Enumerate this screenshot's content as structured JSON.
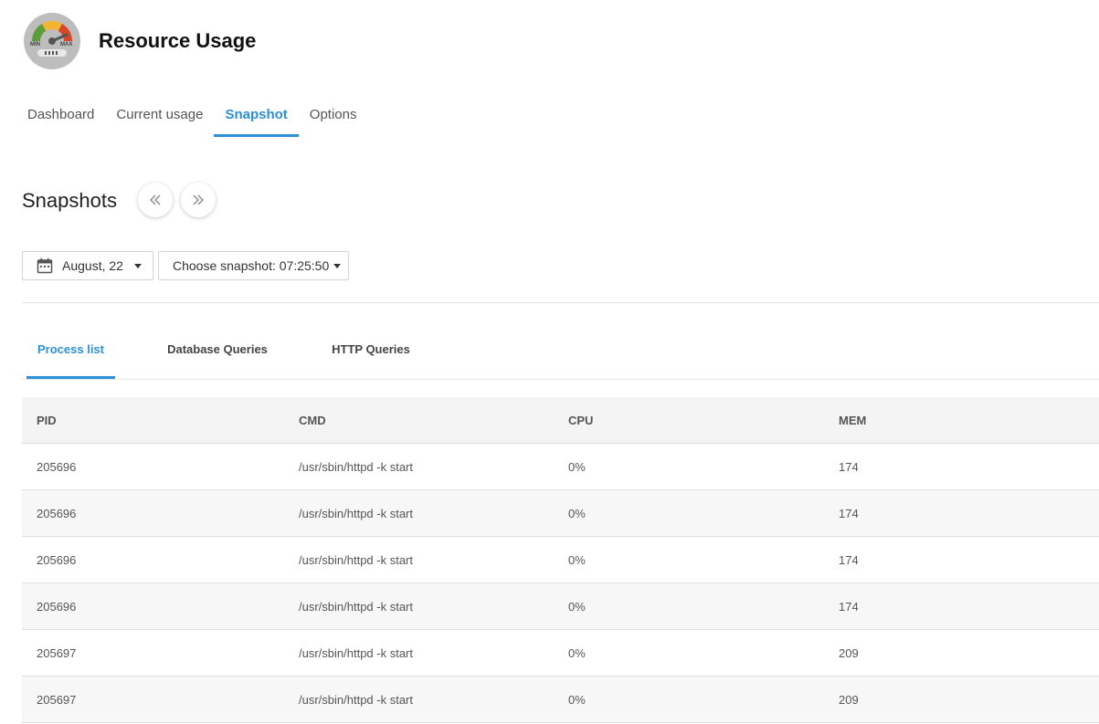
{
  "app": {
    "title": "Resource Usage",
    "logo_icon": "gauge-icon",
    "logo_min": "MIN",
    "logo_max": "MAX"
  },
  "main_tabs": [
    {
      "label": "Dashboard",
      "active": false
    },
    {
      "label": "Current usage",
      "active": false
    },
    {
      "label": "Snapshot",
      "active": true
    },
    {
      "label": "Options",
      "active": false
    }
  ],
  "snapshots": {
    "title": "Snapshots",
    "prev_icon": "double-chevron-left-icon",
    "next_icon": "double-chevron-right-icon",
    "date_label": "August, 22",
    "snapshot_label": "Choose snapshot: 07:25:50"
  },
  "sub_tabs": [
    {
      "label": "Process list",
      "active": true
    },
    {
      "label": "Database Queries",
      "active": false
    },
    {
      "label": "HTTP Queries",
      "active": false
    }
  ],
  "table": {
    "columns": [
      "PID",
      "CMD",
      "CPU",
      "MEM"
    ],
    "rows": [
      [
        "205696",
        "/usr/sbin/httpd -k start",
        "0%",
        "174"
      ],
      [
        "205696",
        "/usr/sbin/httpd -k start",
        "0%",
        "174"
      ],
      [
        "205696",
        "/usr/sbin/httpd -k start",
        "0%",
        "174"
      ],
      [
        "205696",
        "/usr/sbin/httpd -k start",
        "0%",
        "174"
      ],
      [
        "205697",
        "/usr/sbin/httpd -k start",
        "0%",
        "209"
      ],
      [
        "205697",
        "/usr/sbin/httpd -k start",
        "0%",
        "209"
      ]
    ]
  },
  "colors": {
    "accent": "#2d8fd8",
    "header_bg": "#f4f4f4",
    "row_alt_bg": "#f7f7f7"
  }
}
